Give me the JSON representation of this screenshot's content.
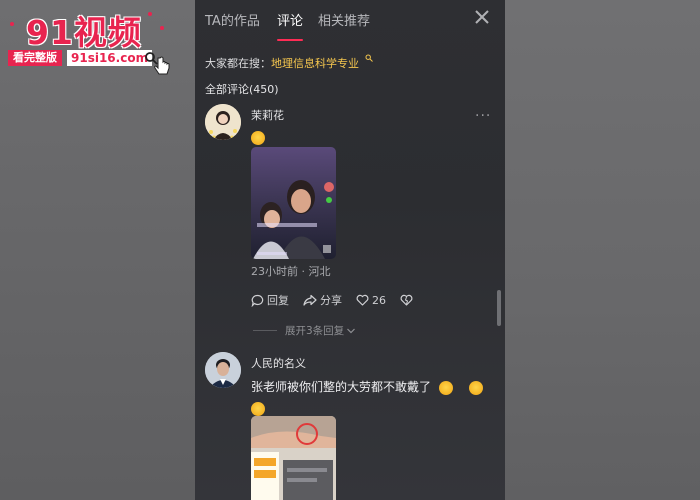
{
  "watermark": {
    "logo": "91视频",
    "tag": "看完整版",
    "url": "91si16.com"
  },
  "tabs": [
    {
      "label": "TA的作品",
      "active": false
    },
    {
      "label": "评论",
      "active": true
    },
    {
      "label": "相关推荐",
      "active": false
    }
  ],
  "search_hint": {
    "prefix": "大家都在搜：",
    "keyword": "地理信息科学专业"
  },
  "comment_count_label": "全部评论(450)",
  "comments": [
    {
      "username": "茉莉花",
      "text": "",
      "emoji_count": 1,
      "meta": "23小时前 · 河北",
      "actions": {
        "reply": "回复",
        "share": "分享",
        "likes": "26"
      },
      "expand_label": "展开3条回复"
    },
    {
      "username": "人民的名义",
      "text": "张老师被你们整的大劳都不敢戴了"
    }
  ],
  "colors": {
    "accent": "#fe2c55",
    "keyword": "#f5c64e",
    "watermark": "#e8244f"
  }
}
